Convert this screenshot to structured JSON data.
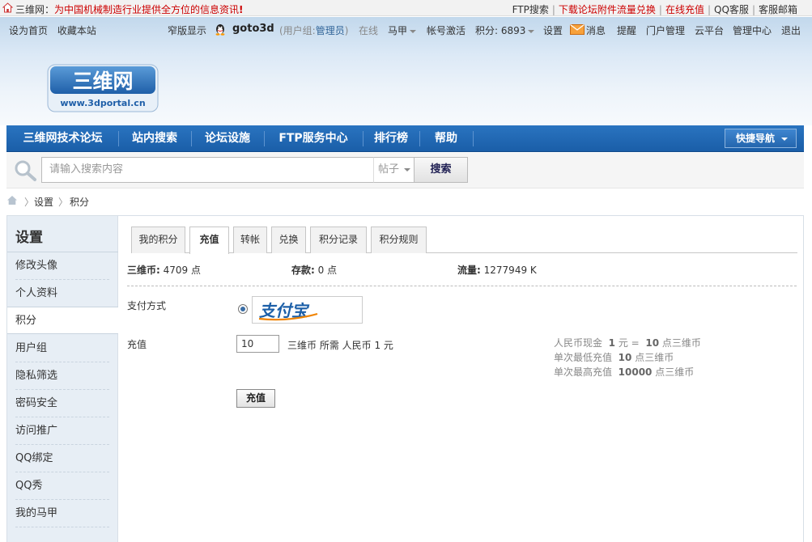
{
  "topbar": {
    "site": "三维网：",
    "slogan": "为中国机械制造行业提供全方位的信息资讯",
    "exclaim": "!",
    "links": [
      {
        "label": "FTP搜索"
      },
      {
        "label": "下载论坛附件流量兑换"
      },
      {
        "label": "在线充值"
      },
      {
        "label": "QQ客服"
      },
      {
        "label": "客服邮箱"
      }
    ]
  },
  "userbar": {
    "set_home": "设为首页",
    "bookmark": "收藏本站",
    "narrow": "窄版显示",
    "username": "goto3d",
    "group_prefix": "(用户组:",
    "group": "管理员",
    "group_suffix": ")",
    "online": "在线",
    "armor": "马甲",
    "activate": "帐号激活",
    "points": "积分: 6893",
    "settings": "设置",
    "messages": "消息",
    "reminders": "提醒",
    "portal_admin": "门户管理",
    "cloud": "云平台",
    "admin_center": "管理中心",
    "logout": "退出"
  },
  "logo": {
    "text": "三维网",
    "url": "www.3dportal.cn"
  },
  "nav": {
    "items": [
      "三维网技术论坛",
      "站内搜索",
      "论坛设施",
      "FTP服务中心",
      "排行榜",
      "帮助"
    ],
    "quick": "快捷导航"
  },
  "search": {
    "placeholder": "请输入搜索内容",
    "type": "帖子",
    "button": "搜索"
  },
  "breadcrumb": {
    "items": [
      "设置",
      "积分"
    ]
  },
  "sidebar": {
    "title": "设置",
    "items": [
      "修改头像",
      "个人资料",
      "积分",
      "用户组",
      "隐私筛选",
      "密码安全",
      "访问推广",
      "QQ绑定",
      "QQ秀",
      "我的马甲"
    ]
  },
  "tabs": [
    "我的积分",
    "充值",
    "转帐",
    "兑换",
    "积分记录",
    "积分规则"
  ],
  "stats": {
    "coin_label": "三维币:",
    "coin_value": "4709 点",
    "deposit_label": "存款:",
    "deposit_value": "0 点",
    "traffic_label": "流量:",
    "traffic_value": "1277949 K"
  },
  "payment": {
    "method_label": "支付方式",
    "alipay_text": "支付宝",
    "amount_label": "充值",
    "amount_value": "10",
    "amount_unit": "三维币  所需 人民币 1 元",
    "rate_1_pre": "人民币现金",
    "rate_1_a": "1",
    "rate_1_mid": "元 =",
    "rate_1_b": "10",
    "rate_1_post": "点三维币",
    "rate_2_pre": "单次最低充值",
    "rate_2_val": "10",
    "rate_2_post": "点三维币",
    "rate_3_pre": "单次最高充值",
    "rate_3_val": "10000",
    "rate_3_post": "点三维币",
    "submit": "充值"
  }
}
